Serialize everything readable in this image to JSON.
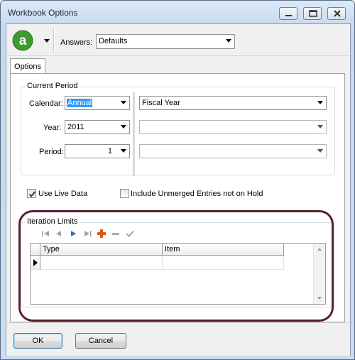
{
  "window": {
    "title": "Workbook Options"
  },
  "toolbar": {
    "answers_label": "Answers:",
    "answers_value": "Defaults"
  },
  "tabs": [
    {
      "label": "Options"
    }
  ],
  "current_period": {
    "legend": "Current Period",
    "calendar_label": "Calendar:",
    "calendar_value": "Annual",
    "year_label": "Year:",
    "year_value": "2011",
    "period_label": "Period:",
    "period_value": "1",
    "fiscal_value": "Fiscal Year",
    "secondary_value": "",
    "tertiary_value": ""
  },
  "options": {
    "use_live_data_label": "Use Live Data",
    "use_live_data_checked": true,
    "include_unmerged_label": "Include Unmerged Entries not on Hold",
    "include_unmerged_checked": false
  },
  "iteration_limits": {
    "legend": "Iteration Limits",
    "columns": [
      "Type",
      "Item"
    ],
    "rows": [
      {
        "type": "",
        "item": ""
      }
    ]
  },
  "footer": {
    "ok_label": "OK",
    "cancel_label": "Cancel"
  },
  "colors": {
    "selection": "#3399ff",
    "highlight_ring": "#5a1f2a",
    "logo_green": "#3f9b2d",
    "add_orange": "#e0561a",
    "nav_blue": "#1f6fd1"
  }
}
